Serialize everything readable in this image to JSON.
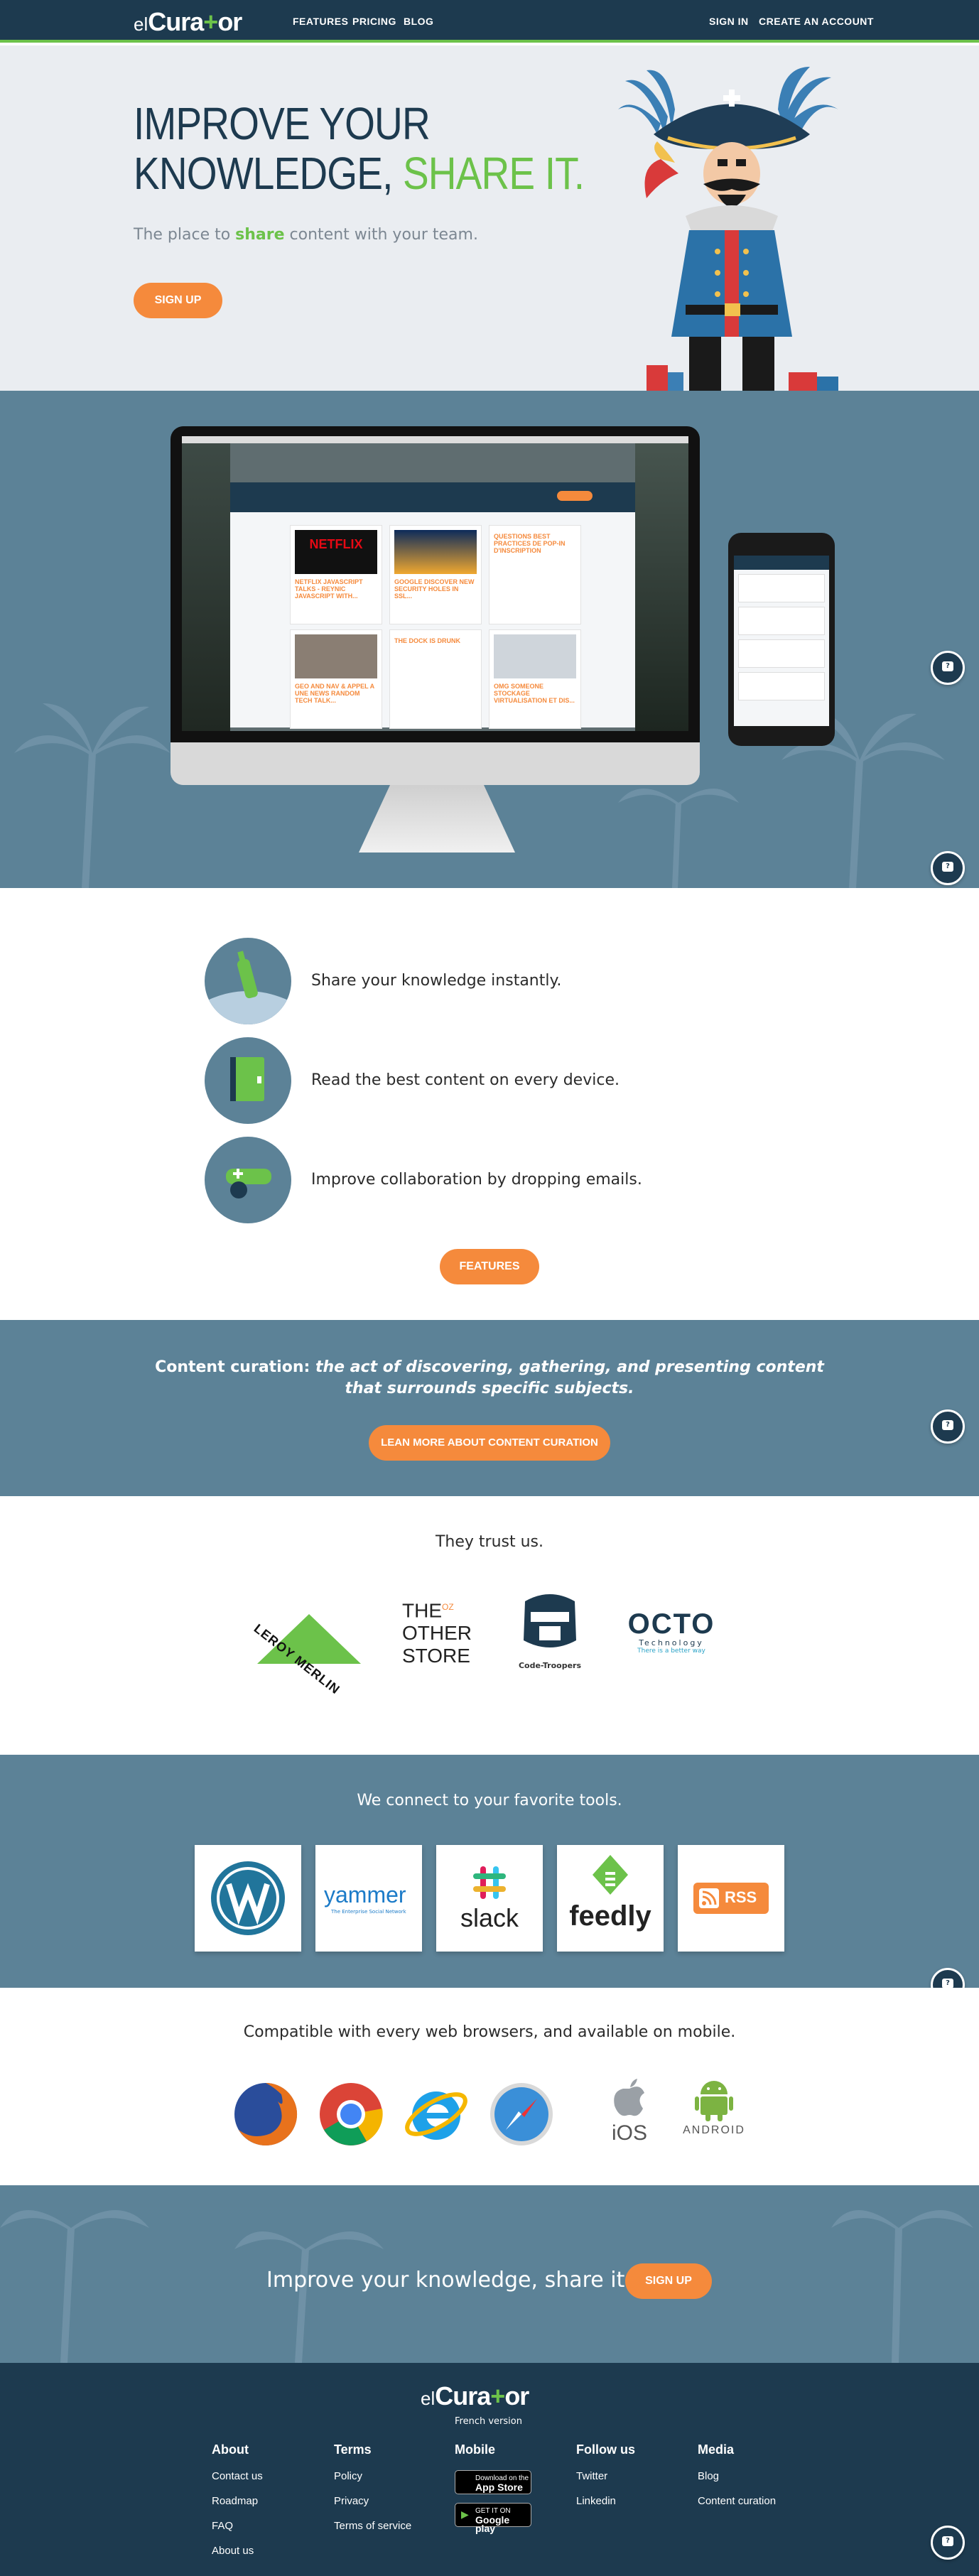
{
  "nav": {
    "logo_prefix": "el",
    "logo_pre": "Cura",
    "logo_plus": "+",
    "logo_post": "or",
    "features": "FEATURES",
    "pricing": "PRICING",
    "blog": "BLOG",
    "signin": "SIGN IN",
    "create_account": "CREATE AN ACCOUNT"
  },
  "hero": {
    "title_line1": "IMPROVE YOUR",
    "title_line2a": "KNOWLEDGE, ",
    "title_line2b": "SHARE IT.",
    "tagline_a": "The place to ",
    "tagline_b": "share",
    "tagline_c": " content with your team.",
    "signup": "SIGN UP"
  },
  "devices": {
    "cards": [
      {
        "title": "NETFLIX JAVASCRIPT TALKS - REYNIC JAVASCRIPT WITH..."
      },
      {
        "title": "GOOGLE DISCOVER NEW SECURITY HOLES IN SSL..."
      },
      {
        "title": "QUESTIONS BEST PRACTICES DE POP-IN D'INSCRIPTION"
      },
      {
        "title": "GEO AND NAV & APPEL A UNE NEWS RANDOM TECH TALK..."
      },
      {
        "title": "THE DOCK IS DRUNK"
      },
      {
        "title": "OMG SOMEONE STOCKAGE VIRTUALISATION ET DIS..."
      }
    ]
  },
  "features": {
    "items": [
      {
        "text": "Share your knowledge instantly."
      },
      {
        "text": "Read the best content on every device."
      },
      {
        "text": "Improve collaboration by dropping emails."
      }
    ],
    "button": "FEATURES"
  },
  "curation": {
    "lead": "Content curation: ",
    "definition_1": "the act of discovering, gathering, and presenting content",
    "definition_2": "that surrounds specific subjects.",
    "button": "LEAN MORE ABOUT CONTENT CURATION"
  },
  "trust": {
    "title": "They trust us.",
    "logos": {
      "leroy": "LEROY MERLIN",
      "other_a": "THE",
      "other_oz": "OZ",
      "other_b": "OTHER",
      "other_c": "STORE",
      "codetroopers": "Code-Troopers",
      "octo": "OCTO",
      "octo_sub": "Technology",
      "octo_tag": "There is a better way"
    }
  },
  "tools": {
    "title": "We connect to your favorite tools.",
    "yammer": "yammer",
    "yammer_sub": "The Enterprise Social Network",
    "slack": "slack",
    "feedly": "feedly",
    "rss": "RSS"
  },
  "browsers": {
    "title": "Compatible with every web browsers, and available on mobile.",
    "ios": "iOS",
    "android": "ANDROID"
  },
  "cta": {
    "text": "Improve your knowledge, share it.",
    "button": "SIGN UP"
  },
  "footer": {
    "logo_prefix": "el",
    "logo_pre": "Cura",
    "logo_plus": "+",
    "logo_post": "or",
    "subtitle": "French version",
    "about": {
      "title": "About",
      "links": [
        "Contact us",
        "Roadmap",
        "FAQ",
        "About us"
      ]
    },
    "terms": {
      "title": "Terms",
      "links": [
        "Policy",
        "Privacy",
        "Terms of service"
      ]
    },
    "mobile": {
      "title": "Mobile",
      "appstore_small": "Download on the",
      "appstore_big": "App Store",
      "play_small": "GET IT ON",
      "play_big": "Google play"
    },
    "follow": {
      "title": "Follow us",
      "links": [
        "Twitter",
        "Linkedin"
      ]
    },
    "media": {
      "title": "Media",
      "links": [
        "Blog",
        "Content curation"
      ]
    }
  },
  "colors": {
    "navy": "#1d3a4f",
    "green": "#6cc24a",
    "orange": "#f58a3c",
    "steel": "#5c8297"
  }
}
